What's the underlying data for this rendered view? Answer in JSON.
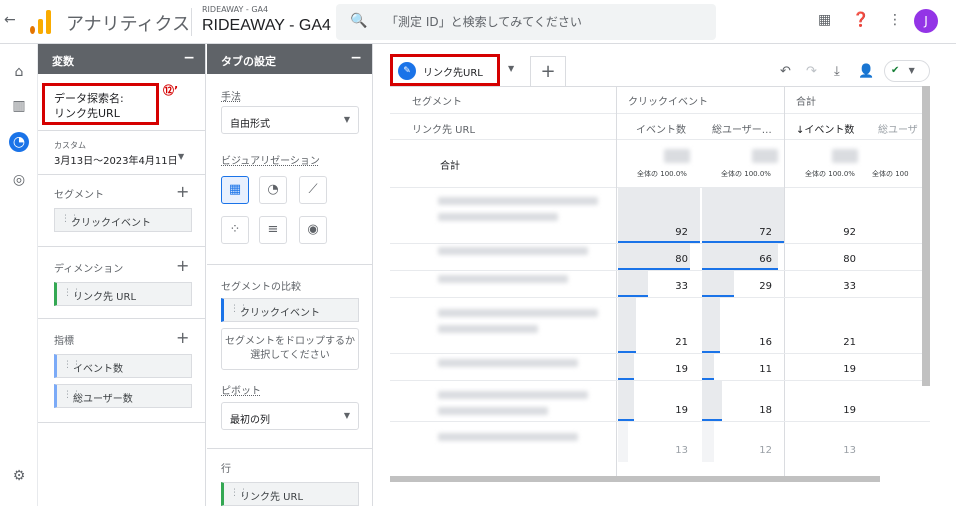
{
  "header": {
    "app_title": "アナリティクス",
    "property_account": "RIDEAWAY - GA4",
    "property_name": "RIDEAWAY - GA4",
    "search_placeholder": "「測定 ID」と検索してみてください",
    "avatar_letter": "J"
  },
  "variables_panel": {
    "title": "変数",
    "exploration_name_label": "データ探索名:",
    "exploration_name_value": "リンク先URL",
    "date_label": "カスタム",
    "date_range": "3月13日～2023年4月11日",
    "segments_label": "セグメント",
    "segments": [
      "クリックイベント"
    ],
    "dimensions_label": "ディメンション",
    "dimensions": [
      "リンク先 URL"
    ],
    "metrics_label": "指標",
    "metrics": [
      "イベント数",
      "総ユーザー数"
    ]
  },
  "annotation": {
    "label": "⑫’"
  },
  "tab_settings": {
    "title": "タブの設定",
    "technique_label": "手法",
    "technique_value": "自由形式",
    "visualization_label": "ビジュアリゼーション",
    "segment_comparison_label": "セグメントの比較",
    "segment_comparison_chip": "クリックイベント",
    "segment_drop_text": "セグメントをドロップするか選択してください",
    "pivot_label": "ピボット",
    "pivot_value": "最初の列",
    "rows_label": "行",
    "rows_chip": "リンク先 URL"
  },
  "tabs": [
    {
      "label": "リンク先URL"
    }
  ],
  "table": {
    "segment_header": "セグメント",
    "dimension_header": "リンク先 URL",
    "group1": "クリックイベント",
    "group2": "合計",
    "col1": "イベント数",
    "col2": "総ユーザー…",
    "col3": "↓イベント数",
    "col4": "総ユーザ",
    "total_label": "合計",
    "pct1": "全体の 100.0%",
    "pct2": "全体の 100.0%",
    "pct3": "全体の 100.0%",
    "pct4": "全体の 100",
    "rows": [
      {
        "c1": "92",
        "c2": "72",
        "c3": "92"
      },
      {
        "c1": "80",
        "c2": "66",
        "c3": "80"
      },
      {
        "c1": "33",
        "c2": "29",
        "c3": "33"
      },
      {
        "c1": "21",
        "c2": "16",
        "c3": "21"
      },
      {
        "c1": "19",
        "c2": "11",
        "c3": "19"
      },
      {
        "c1": "19",
        "c2": "18",
        "c3": "19"
      },
      {
        "c1": "13",
        "c2": "12",
        "c3": "13"
      }
    ]
  },
  "colors": {
    "accent": "#1a73e8",
    "annotation": "#d50000",
    "header_bg": "#5f6368"
  }
}
